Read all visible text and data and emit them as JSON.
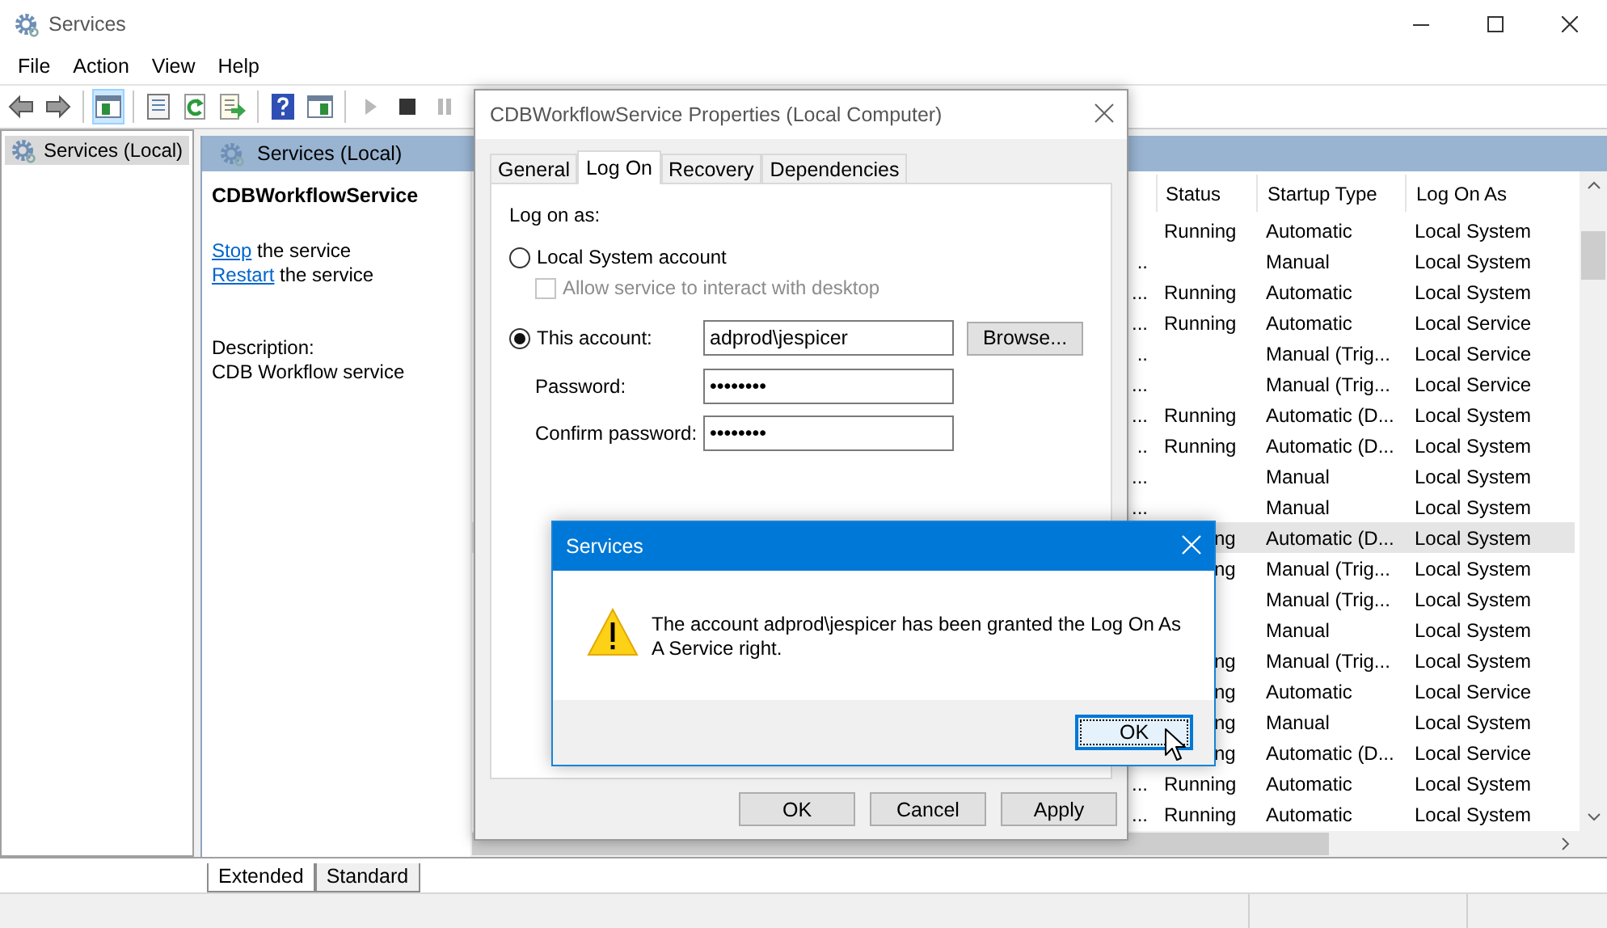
{
  "window": {
    "title": "Services"
  },
  "menu": [
    "File",
    "Action",
    "View",
    "Help"
  ],
  "toolbar": [
    {
      "kind": "back",
      "disabled": false,
      "pressed": false
    },
    {
      "kind": "forward",
      "disabled": false,
      "pressed": false
    },
    {
      "kind": "separator"
    },
    {
      "kind": "tree-toggle",
      "disabled": false,
      "pressed": true
    },
    {
      "kind": "separator"
    },
    {
      "kind": "properties",
      "disabled": false,
      "pressed": false
    },
    {
      "kind": "refresh",
      "disabled": false,
      "pressed": false
    },
    {
      "kind": "export",
      "disabled": false,
      "pressed": false
    },
    {
      "kind": "separator"
    },
    {
      "kind": "help",
      "disabled": false,
      "pressed": false
    },
    {
      "kind": "console",
      "disabled": false,
      "pressed": false
    },
    {
      "kind": "separator"
    },
    {
      "kind": "start",
      "disabled": true,
      "pressed": false
    },
    {
      "kind": "stop",
      "disabled": false,
      "pressed": false
    },
    {
      "kind": "pause",
      "disabled": true,
      "pressed": false
    }
  ],
  "tree": {
    "items": [
      {
        "label": "Services (Local)",
        "selected": true
      }
    ]
  },
  "pane": {
    "title": "Services (Local)"
  },
  "details": {
    "service_name": "CDBWorkflowService",
    "actions": [
      {
        "link": "Stop",
        "text": " the service"
      },
      {
        "link": "Restart",
        "text": " the service"
      }
    ],
    "description_label": "Description:",
    "description": "CDB Workflow service"
  },
  "table": {
    "columns": [
      "Status",
      "Startup Type",
      "Log On As"
    ],
    "rows": [
      {
        "column_1": "",
        "status": "Running",
        "startup_type": "Automatic",
        "log_on_as": "Local System",
        "selected": false,
        "covered": false
      },
      {
        "column_1": "..",
        "status": "",
        "startup_type": "Manual",
        "log_on_as": "Local System",
        "selected": false
      },
      {
        "column_1": "...",
        "status": "Running",
        "startup_type": "Automatic",
        "log_on_as": "Local System",
        "selected": false,
        "covered": false
      },
      {
        "column_1": "...",
        "status": "Running",
        "startup_type": "Automatic",
        "log_on_as": "Local Service",
        "selected": false,
        "covered": false
      },
      {
        "column_1": "..",
        "status": "",
        "startup_type": "Manual (Trig...",
        "log_on_as": "Local Service",
        "selected": false
      },
      {
        "column_1": "...",
        "status": "",
        "startup_type": "Manual (Trig...",
        "log_on_as": "Local Service",
        "selected": false
      },
      {
        "column_1": "...",
        "status": "Running",
        "startup_type": "Automatic (D...",
        "log_on_as": "Local System",
        "selected": false,
        "covered": false
      },
      {
        "column_1": "..",
        "status": "Running",
        "startup_type": "Automatic (D...",
        "log_on_as": "Local System",
        "selected": false,
        "covered": false
      },
      {
        "column_1": "...",
        "status": "",
        "startup_type": "Manual",
        "log_on_as": "Local System",
        "selected": false
      },
      {
        "column_1": "...",
        "status": "",
        "startup_type": "Manual",
        "log_on_as": "Local System",
        "selected": false
      },
      {
        "column_1": "",
        "status": "ng",
        "startup_type": "Automatic (D...",
        "log_on_as": "Local System",
        "selected": true,
        "covered": true
      },
      {
        "column_1": "",
        "status": "ng",
        "startup_type": "Manual (Trig...",
        "log_on_as": "Local System",
        "selected": false,
        "covered": true
      },
      {
        "column_1": "",
        "status": "",
        "startup_type": "Manual (Trig...",
        "log_on_as": "Local System",
        "selected": false
      },
      {
        "column_1": "",
        "status": "",
        "startup_type": "Manual",
        "log_on_as": "Local System",
        "selected": false
      },
      {
        "column_1": "",
        "status": "ng",
        "startup_type": "Manual (Trig...",
        "log_on_as": "Local System",
        "selected": false,
        "covered": true
      },
      {
        "column_1": "",
        "status": "ng",
        "startup_type": "Automatic",
        "log_on_as": "Local Service",
        "selected": false,
        "covered": true
      },
      {
        "column_1": "",
        "status": "ng",
        "startup_type": "Manual",
        "log_on_as": "Local System",
        "selected": false,
        "covered": true
      },
      {
        "column_1": "",
        "status": "ng",
        "startup_type": "Automatic (D...",
        "log_on_as": "Local Service",
        "selected": false,
        "covered": true
      },
      {
        "column_1": "...",
        "status": "Running",
        "startup_type": "Automatic",
        "log_on_as": "Local System",
        "selected": false,
        "covered": false
      },
      {
        "column_1": "...",
        "status": "Running",
        "startup_type": "Automatic",
        "log_on_as": "Local System",
        "selected": false,
        "covered": false
      }
    ]
  },
  "view_tabs": [
    {
      "label": "Extended",
      "selected": true
    },
    {
      "label": "Standard",
      "selected": false
    }
  ],
  "properties_dialog": {
    "title": "CDBWorkflowService Properties (Local Computer)",
    "tabs": [
      {
        "label": "General",
        "selected": false
      },
      {
        "label": "Log On",
        "selected": true
      },
      {
        "label": "Recovery",
        "selected": false
      },
      {
        "label": "Dependencies",
        "selected": false
      }
    ],
    "log_on_label": "Log on as:",
    "options": [
      {
        "label": "Local System account",
        "selected": false
      },
      {
        "label": "This account:",
        "selected": true
      }
    ],
    "interact_checkbox": {
      "label": "Allow service to interact with desktop",
      "checked": false,
      "disabled": true
    },
    "account": "adprod\\jespicer",
    "browse": "Browse...",
    "password_label": "Password:",
    "password": "••••••••",
    "confirm_label": "Confirm password:",
    "confirm": "••••••••",
    "buttons": [
      "OK",
      "Cancel",
      "Apply"
    ]
  },
  "message_box": {
    "title": "Services",
    "message": "The account adprod\\jespicer has been granted the Log On As A Service right.",
    "button": "OK"
  }
}
